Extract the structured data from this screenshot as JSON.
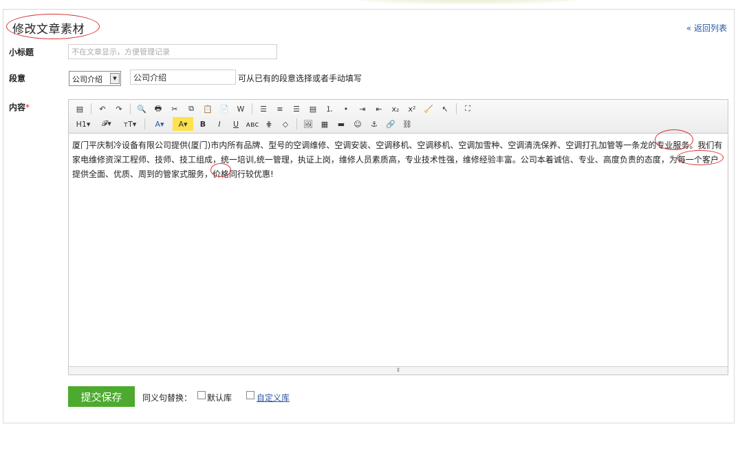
{
  "page": {
    "title": "修改文章素材",
    "back_link": "« 返回列表"
  },
  "fields": {
    "subtitle": {
      "label": "小标题",
      "value": "",
      "placeholder": "不在文章显示，方便管理记录"
    },
    "paragraph": {
      "label": "段意",
      "selected": "公司介绍",
      "value": "公司介绍",
      "hint": "可从已有的段意选择或者手动填写"
    },
    "content": {
      "label": "内容",
      "required_mark": "*"
    }
  },
  "editor": {
    "toolbar_row1": [
      {
        "name": "source-icon",
        "glyph": "▤"
      },
      {
        "sep": true
      },
      {
        "name": "undo-icon",
        "glyph": "↶"
      },
      {
        "name": "redo-icon",
        "glyph": "↷"
      },
      {
        "sep": true
      },
      {
        "name": "preview-icon",
        "glyph": "🔍"
      },
      {
        "name": "print-icon",
        "glyph": "🖶"
      },
      {
        "name": "cut-icon",
        "glyph": "✂"
      },
      {
        "name": "copy-icon",
        "glyph": "⧉"
      },
      {
        "name": "paste-icon",
        "glyph": "📋"
      },
      {
        "name": "paste-text-icon",
        "glyph": "📄"
      },
      {
        "name": "paste-word-icon",
        "glyph": "W"
      },
      {
        "sep": true
      },
      {
        "name": "align-left-icon",
        "glyph": "☰"
      },
      {
        "name": "align-center-icon",
        "glyph": "≡"
      },
      {
        "name": "align-right-icon",
        "glyph": "☰"
      },
      {
        "name": "align-justify-icon",
        "glyph": "▤"
      },
      {
        "name": "ordered-list-icon",
        "glyph": "⒈"
      },
      {
        "name": "unordered-list-icon",
        "glyph": "•"
      },
      {
        "name": "indent-icon",
        "glyph": "⇥"
      },
      {
        "name": "outdent-icon",
        "glyph": "⇤"
      },
      {
        "name": "subscript-icon",
        "glyph": "x₂"
      },
      {
        "name": "superscript-icon",
        "glyph": "x²"
      },
      {
        "name": "clear-format-icon",
        "glyph": "🧹"
      },
      {
        "name": "select-all-icon",
        "glyph": "↖"
      },
      {
        "sep": true
      },
      {
        "name": "fullscreen-icon",
        "glyph": "⛶"
      }
    ],
    "toolbar_row2": [
      {
        "name": "heading-icon",
        "glyph": "H1▾",
        "wide": true
      },
      {
        "name": "font-family-icon",
        "glyph": "𝓕▾",
        "wide": true
      },
      {
        "name": "font-size-icon",
        "glyph": "тT▾",
        "wide": true
      },
      {
        "sep": true
      },
      {
        "name": "font-color-icon",
        "glyph": "A▾",
        "wide": true
      },
      {
        "name": "highlight-color-icon",
        "glyph": "A▾",
        "wide": true
      },
      {
        "name": "bold-icon",
        "glyph": "B"
      },
      {
        "name": "italic-icon",
        "glyph": "I"
      },
      {
        "name": "underline-icon",
        "glyph": "U"
      },
      {
        "name": "strikethrough-icon",
        "glyph": "ᴀʙᴄ"
      },
      {
        "name": "horizontal-rule-icon",
        "glyph": "⋕"
      },
      {
        "name": "eraser-icon",
        "glyph": "◇"
      },
      {
        "sep": true
      },
      {
        "name": "image-icon",
        "glyph": "🖼"
      },
      {
        "name": "table-icon",
        "glyph": "▦"
      },
      {
        "name": "insert-media-icon",
        "glyph": "▬"
      },
      {
        "name": "emoticon-icon",
        "glyph": "☺"
      },
      {
        "name": "anchor-icon",
        "glyph": "⚓"
      },
      {
        "name": "link-icon",
        "glyph": "🔗"
      },
      {
        "name": "unlink-icon",
        "glyph": "⛓"
      }
    ],
    "content_text": "厦门平庆制冷设备有限公司提供(厦门)市内所有品牌、型号的空调维修、空调安装、空调移机、空调移机、空调加雪种、空调清洗保养、空调打孔加管等一条龙的专业服务。我们有家电维修资深工程师、技师、技工组成，统一培训,统一管理，执证上岗，维修人员素质高，专业技术性强，维修经验丰富。公司本着诚信、专业、高度负责的态度，为每一个客户提供全面、优质、周到的管家式服务，价格同行较优惠!"
  },
  "actions": {
    "submit_label": "提交保存",
    "synonym_label": "同义句替换：",
    "default_lib_label": "默认库",
    "custom_lib_label": "自定义库"
  },
  "colors": {
    "accent_green": "#4caa2e",
    "link_blue": "#2a57a3",
    "annotation_red": "#d63030"
  }
}
